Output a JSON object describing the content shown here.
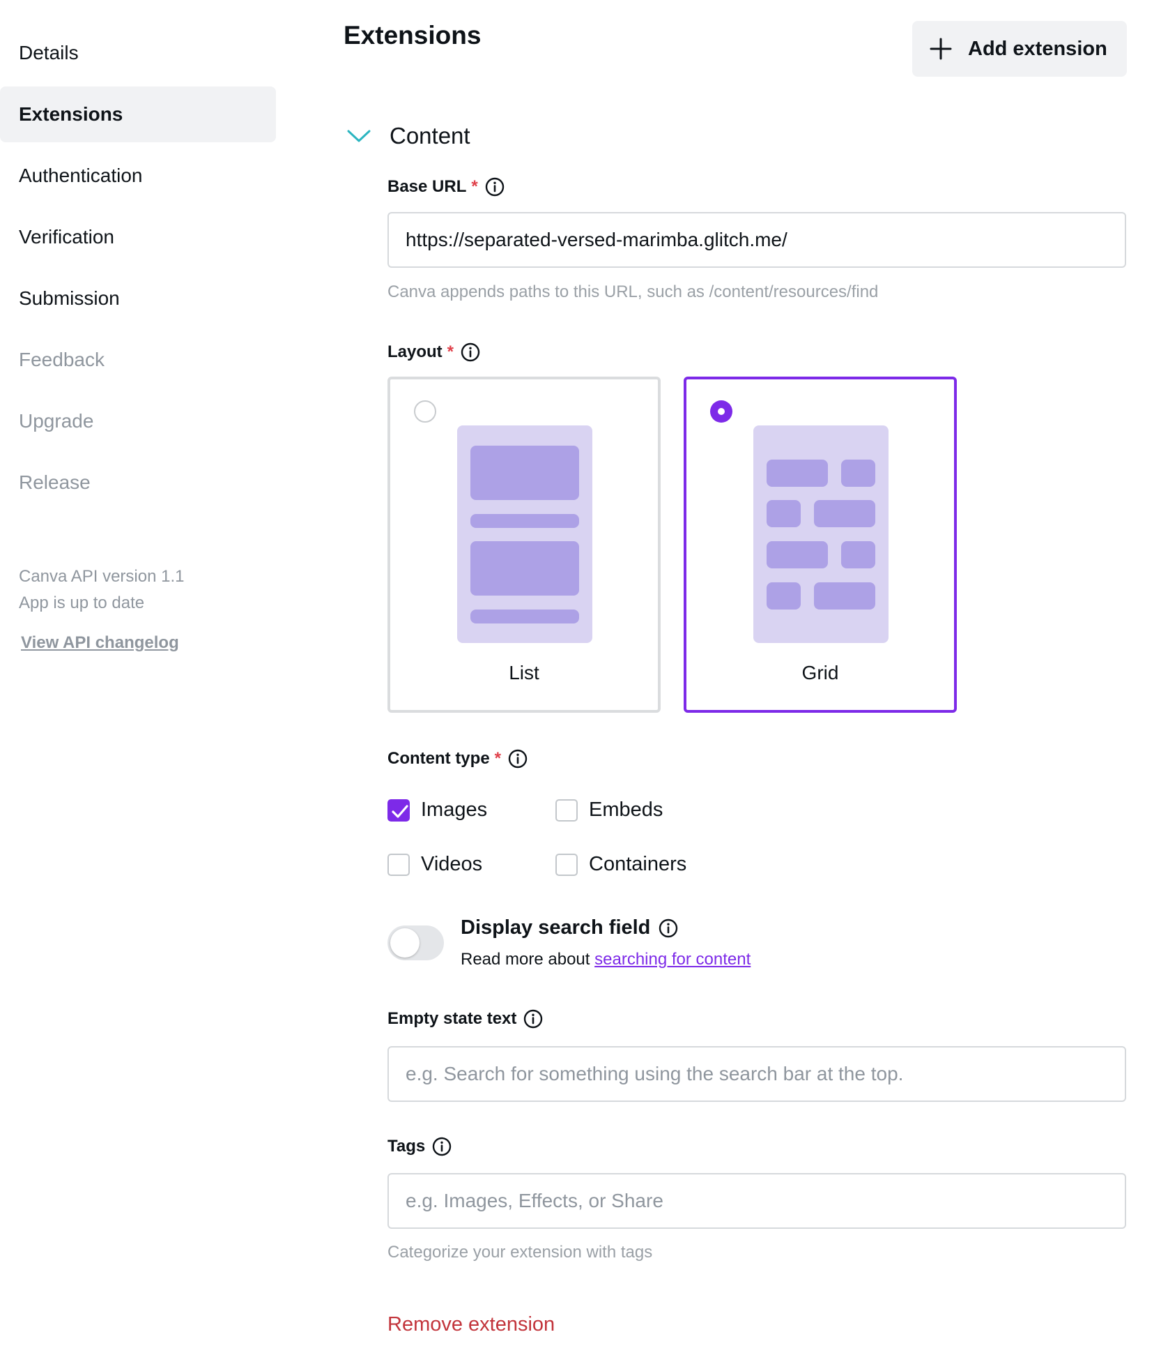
{
  "sidebar": {
    "items": [
      {
        "label": "Details"
      },
      {
        "label": "Extensions"
      },
      {
        "label": "Authentication"
      },
      {
        "label": "Verification"
      },
      {
        "label": "Submission"
      },
      {
        "label": "Feedback"
      },
      {
        "label": "Upgrade"
      },
      {
        "label": "Release"
      }
    ],
    "active": "Extensions",
    "api_version": "Canva API version 1.1",
    "app_status": "App is up to date",
    "changelog_link": "View API changelog"
  },
  "header": {
    "title": "Extensions",
    "add_button_label": "Add extension"
  },
  "content": {
    "section_title": "Content",
    "base_url": {
      "label": "Base URL",
      "required_mark": "*",
      "value": "https://separated-versed-marimba.glitch.me/",
      "help": "Canva appends paths to this URL, such as /content/resources/find"
    },
    "layout": {
      "label": "Layout",
      "required_mark": "*",
      "options": [
        {
          "label": "List",
          "selected": false
        },
        {
          "label": "Grid",
          "selected": true
        }
      ]
    },
    "content_type": {
      "label": "Content type",
      "required_mark": "*",
      "options": [
        {
          "label": "Images",
          "checked": true
        },
        {
          "label": "Embeds",
          "checked": false
        },
        {
          "label": "Videos",
          "checked": false
        },
        {
          "label": "Containers",
          "checked": false
        }
      ]
    },
    "search_field": {
      "title": "Display search field",
      "enabled": false,
      "sub_prefix": "Read more about ",
      "sub_link": "searching for content"
    },
    "empty_state": {
      "label": "Empty state text",
      "placeholder": "e.g. Search for something using the search bar at the top."
    },
    "tags": {
      "label": "Tags",
      "placeholder": "e.g. Images, Effects, or Share",
      "help": "Categorize your extension with tags"
    },
    "remove_label": "Remove extension"
  },
  "colors": {
    "accent": "#7d2ae8",
    "chevron": "#2bb5c0",
    "danger": "#c2343b",
    "required": "#e0404a"
  }
}
